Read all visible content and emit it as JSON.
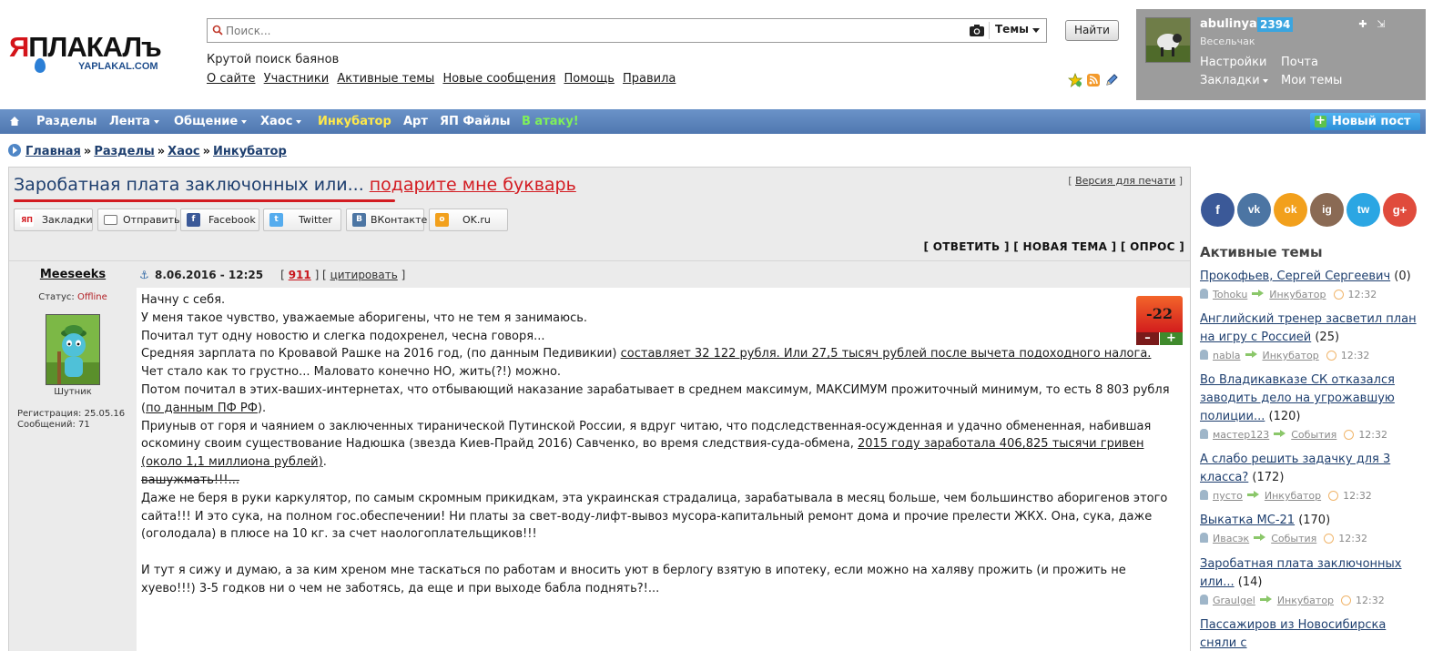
{
  "logo": {
    "text_ya": "Я",
    "text_rest": "ПЛАКАЛъ",
    "subtitle": "YAPLAKAL.COM"
  },
  "search": {
    "placeholder": "Поиск...",
    "scope": "Темы",
    "button": "Найти"
  },
  "tagline": "Крутой поиск баянов",
  "top_links": [
    "О сайте",
    "Участники",
    "Активные темы",
    "Новые сообщения",
    "Помощь",
    "Правила"
  ],
  "header_icons": [
    "star-icon",
    "rss-icon",
    "pencil-icon"
  ],
  "user": {
    "name": "abulinya",
    "reputation": "2394",
    "rank": "Весельчак",
    "links": [
      "Настройки",
      "Почта",
      "Закладки",
      "Мои темы"
    ]
  },
  "nav": {
    "items": [
      "Разделы",
      "Лента",
      "Общение",
      "Хаос",
      "Инкубатор",
      "Арт",
      "ЯП Файлы",
      "В атаку!"
    ],
    "new_post": "Новый пост"
  },
  "breadcrumb": [
    "Главная",
    "Разделы",
    "Хаос",
    "Инкубатор"
  ],
  "breadcrumb_sep": "»",
  "topic": {
    "title": "Заробатная плата заключонных или...",
    "subtitle": "подарите мне букварь",
    "print_link": "Версия для печати",
    "share_buttons": [
      "Закладки",
      "Отправить",
      "Facebook",
      "Twitter",
      "ВКонтакте",
      "OK.ru"
    ],
    "actions": "[ ОТВЕТИТЬ ] [ НОВАЯ ТЕМА ] [ ОПРОС ]"
  },
  "post": {
    "author": "Meeseeks",
    "status_label": "Статус:",
    "status": "Offline",
    "rank": "Шутник",
    "registration": "Регистрация: 25.05.16",
    "messages": "Сообщений: 71",
    "date": "8.06.2016 - 12:25",
    "number": "911",
    "quote": "цитировать",
    "rating": "-22",
    "rating_minus": "–",
    "rating_plus": "+",
    "lines": {
      "l1": "Начну с себя.",
      "l2": "У меня такое чувство, уважаемые аборигены, что не тем я занимаюсь.",
      "l3": "Почитал тут одну новостю и слегка подохренел, чесна говоря...",
      "l4a": "Средняя зарплата по Кровавой Рашке на 2016 год, (по данным Педивикии) ",
      "l4b": "составляет 32 122 рубля. Или 27,5 тысяч рублей после вычета подоходного налога.",
      "l5": "Чет стало как то грустно... Маловато конечно НО, жить(?!) можно.",
      "l6a": "Потом почитал в этих-ваших-интернетах, что отбывающий наказание зарабатывает в среднем максимум, МАКСИМУМ прожиточный минимум, то есть 8 803 рубля (",
      "l6b": "по данным ПФ РФ",
      "l6c": ").",
      "l7a": "Приуныв от горя и чаянием о заключенных тиранической Путинской России, я вдруг читаю, что подследственная-осужденная и удачно обмененная, набившая оскомину своим существование Надюшка (звезда Киев-Прайд 2016) Савченко, во время следствия-суда-обмена, ",
      "l7b": "2015 году заработала 406,825 тысячи гривен (около 1,1 миллиона рублей)",
      "l7c": ".",
      "l8": "вашужмать!!!...",
      "l9": "Даже не беря в руки каркулятор, по самым скромным прикидкам, эта украинская страдалица, зарабатывала в месяц больше, чем большинство аборигенов этого сайта!!! И это сука, на полном гос.обеспечении! Ни платы за свет-воду-лифт-вывоз мусора-капитальный ремонт дома и прочие прелести ЖКХ. Она, сука, даже (оголодала) в плюсе на 10 кг. за счет наологоплательщиков!!!",
      "l10": "И тут я сижу и думаю, а за ким хреном мне таскаться по работам и вносить уют в берлогу взятую в ипотеку, если можно на халяву прожить (и прожить не хуево!!!) 3-5 годков ни о чем не заботясь, да еще и при выходе бабла поднять?!..."
    }
  },
  "social_circles": [
    "f",
    "vk",
    "ok",
    "ig",
    "tw",
    "g+"
  ],
  "active_topics": {
    "title": "Активные темы",
    "items": [
      {
        "title": "Прокофьев, Сергей Сергеевич",
        "count": " (0)",
        "user": "Tohoku",
        "section": "Инкубатор",
        "time": "12:32"
      },
      {
        "title": "Английский тренер засветил план на игру с Россией",
        "count": " (25)",
        "user": "nabla",
        "section": "Инкубатор",
        "time": "12:32"
      },
      {
        "title": "Во Владикавказе СК отказался заводить дело на угрожавшую полиции...",
        "count": " (120)",
        "user": "мастер123",
        "section": "События",
        "time": "12:32"
      },
      {
        "title": "А слабо решить задачку для 3 класса?",
        "count": " (172)",
        "user": "пусто",
        "section": "Инкубатор",
        "time": "12:32"
      },
      {
        "title": "Выкатка МС-21",
        "count": " (170)",
        "user": "Ивасэк",
        "section": "События",
        "time": "12:32"
      },
      {
        "title": "Заробатная плата заключонных или...",
        "count": " (14)",
        "user": "GrauIgel",
        "section": "Инкубатор",
        "time": "12:32"
      },
      {
        "title": "Пассажиров из Новосибирска сняли с",
        "count": "",
        "user": "",
        "section": "",
        "time": ""
      }
    ]
  },
  "colors": {
    "brand_red": "#d31c22",
    "nav_blue": "#5a82b9",
    "link_blue": "#1e3f6f",
    "new_post": "#2c8fd8",
    "user_box": "#9c9c9c"
  }
}
